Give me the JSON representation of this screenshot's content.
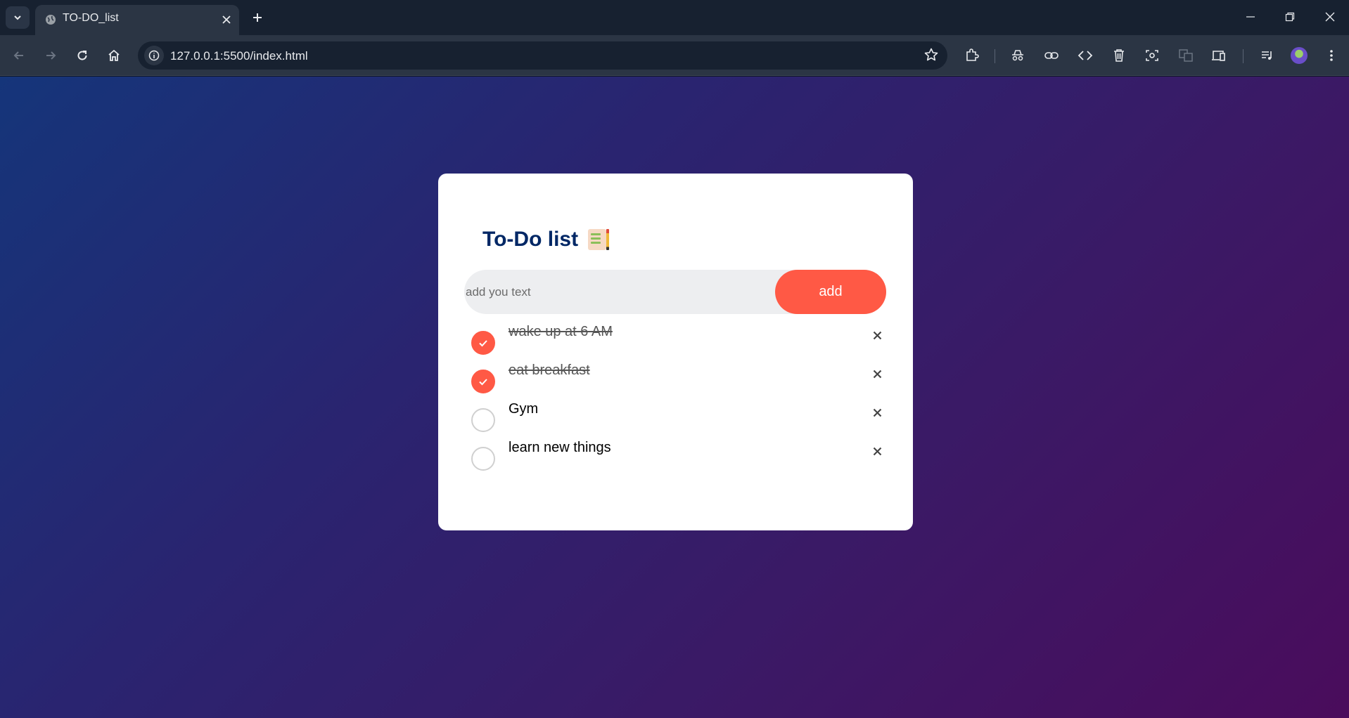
{
  "browser": {
    "tab_title": "TO-DO_list",
    "url": "127.0.0.1:5500/index.html"
  },
  "app": {
    "heading": "To-Do list",
    "heading_icon": "notepad-pencil-emoji",
    "input_placeholder": "add you text",
    "input_value": "",
    "add_label": "add",
    "accent_color": "#ff5945",
    "heading_color": "#002765",
    "tasks": [
      {
        "label": "wake up at 6 AM",
        "done": true
      },
      {
        "label": "eat breakfast",
        "done": true
      },
      {
        "label": "Gym",
        "done": false
      },
      {
        "label": "learn new things",
        "done": false
      }
    ]
  }
}
